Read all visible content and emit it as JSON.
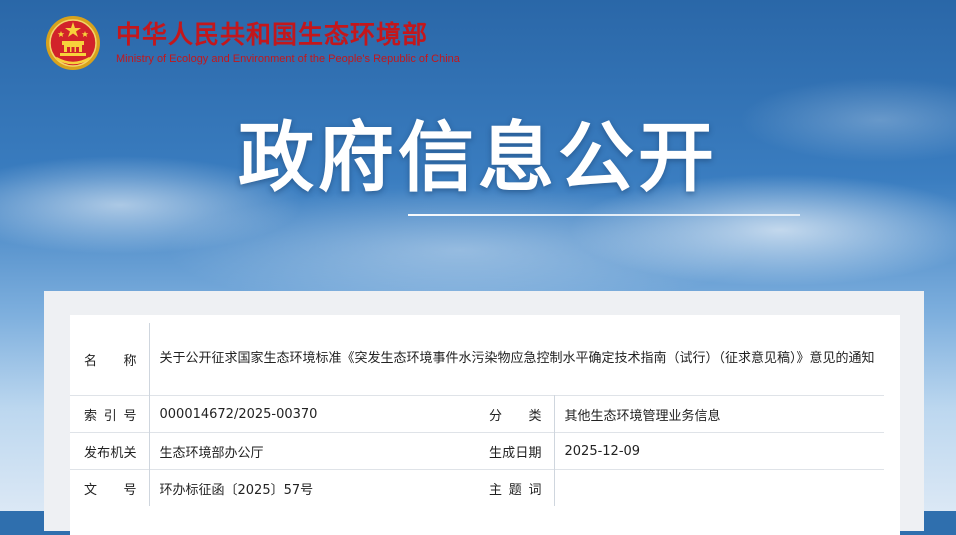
{
  "header": {
    "ministry_cn": "中华人民共和国生态环境部",
    "ministry_en": "Ministry of Ecology and Environment of the People's Republic of China"
  },
  "banner": {
    "title": "政府信息公开"
  },
  "info": {
    "name_label": "名　称",
    "name_value": "关于公开征求国家生态环境标准《突发生态环境事件水污染物应急控制水平确定技术指南（试行）（征求意见稿）》意见的通知",
    "index_label": "索引号",
    "index_value": "000014672/2025-00370",
    "category_label": "分　类",
    "category_value": "其他生态环境管理业务信息",
    "issuer_label": "发布机关",
    "issuer_value": "生态环境部办公厅",
    "date_label": "生成日期",
    "date_value": "2025-12-09",
    "docno_label": "文　号",
    "docno_value": "环办标征函〔2025〕57号",
    "topic_label": "主题词",
    "topic_value": ""
  },
  "colors": {
    "ministry_red": "#c3171c",
    "label_blue": "#1f5fa6"
  },
  "icons": {
    "emblem": "national-emblem-icon"
  }
}
